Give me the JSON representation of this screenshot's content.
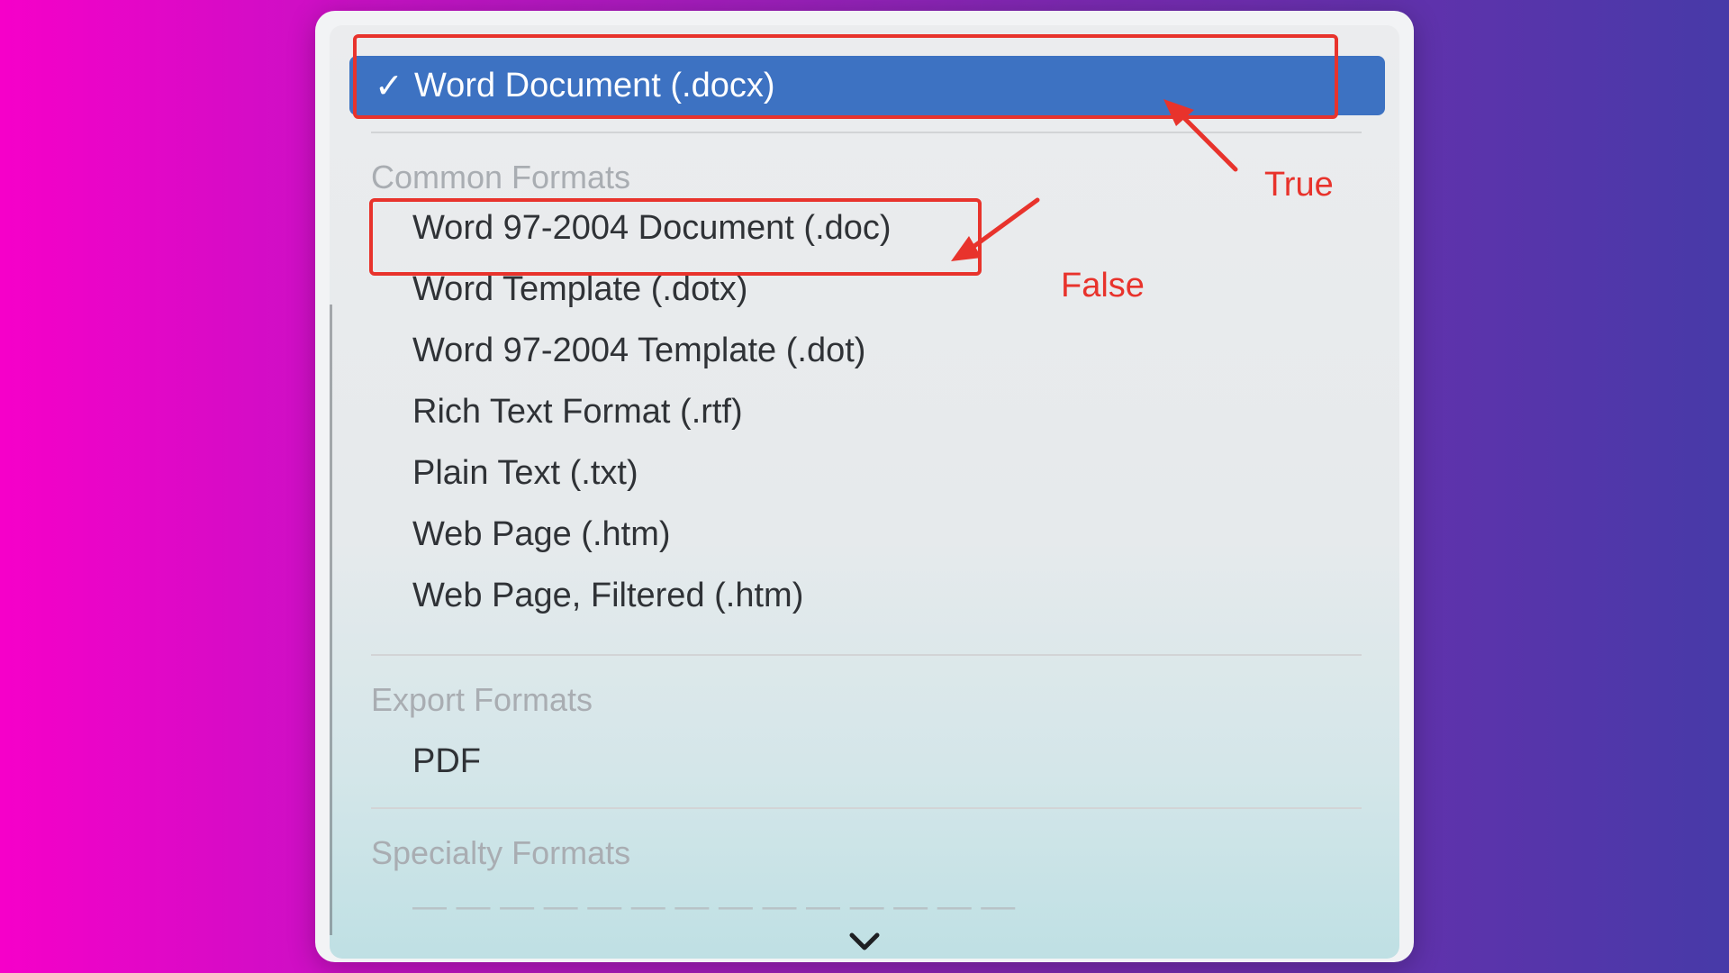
{
  "menu": {
    "selected_label": "Word Document (.docx)",
    "check_glyph": "✓",
    "sections": {
      "common": "Common Formats",
      "export": "Export Formats",
      "specialty": "Specialty Formats"
    },
    "common_items": [
      "Word 97-2004 Document (.doc)",
      "Word Template (.dotx)",
      "Word 97-2004 Template (.dot)",
      "Rich Text Format (.rtf)",
      "Plain Text (.txt)",
      "Web Page (.htm)",
      "Web Page, Filtered (.htm)"
    ],
    "export_items": [
      "PDF"
    ],
    "scroll_more_icon": "chevron-down-icon"
  },
  "annotations": {
    "true_label": "True",
    "false_label": "False",
    "color": "#e8332c"
  },
  "colors": {
    "selection": "#3d72c2"
  }
}
